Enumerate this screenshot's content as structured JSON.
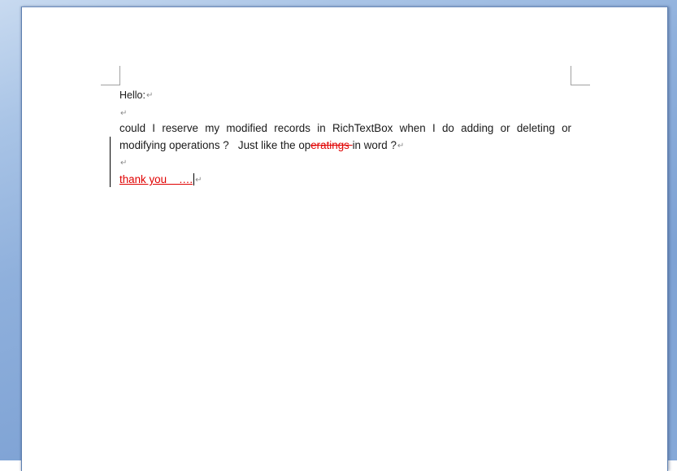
{
  "document": {
    "hello": "Hello:",
    "paragraph_mark": "↵",
    "question_line1_words": [
      "could",
      "I",
      "reserve",
      "my",
      "modified",
      "records",
      "in",
      "RichTextBox",
      "when",
      "I",
      "do",
      "adding",
      "or",
      "deleting",
      "or"
    ],
    "question_line2_prefix": "modifying operations ?   Just like the op",
    "question_deleted": "eratings ",
    "question_line2_suffix": "in word ?",
    "thanks_inserted": "thank you    ….",
    "revision_color": "#e00000"
  }
}
